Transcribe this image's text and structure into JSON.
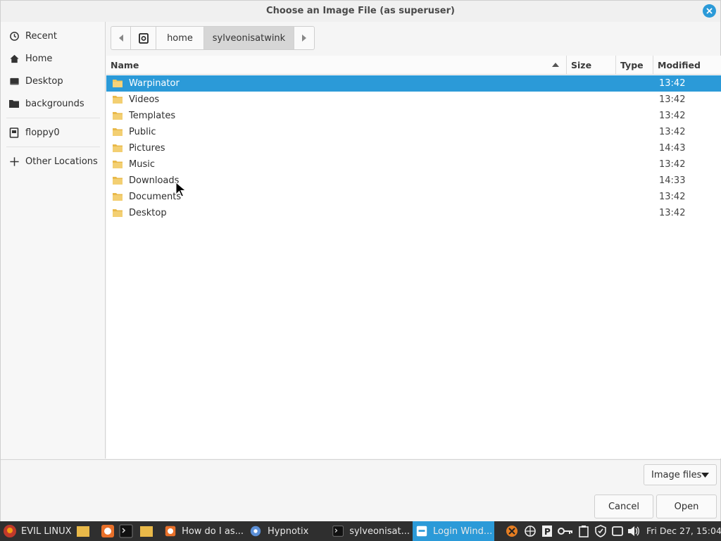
{
  "window": {
    "title": "Choose an Image File (as superuser)"
  },
  "sidebar": {
    "items": [
      {
        "label": "Recent",
        "icon": "clock-icon"
      },
      {
        "label": "Home",
        "icon": "home-icon"
      },
      {
        "label": "Desktop",
        "icon": "desktop-icon"
      },
      {
        "label": "backgrounds",
        "icon": "folder-icon"
      },
      {
        "label": "floppy0",
        "icon": "drive-icon"
      },
      {
        "label": "Other Locations",
        "icon": "plus-icon"
      }
    ]
  },
  "pathbar": {
    "segments": [
      "home",
      "sylveonisatwink"
    ]
  },
  "columns": {
    "name": "Name",
    "size": "Size",
    "type": "Type",
    "modified": "Modified"
  },
  "files": [
    {
      "name": "Warpinator",
      "modified": "13:42",
      "selected": true
    },
    {
      "name": "Videos",
      "modified": "13:42"
    },
    {
      "name": "Templates",
      "modified": "13:42"
    },
    {
      "name": "Public",
      "modified": "13:42"
    },
    {
      "name": "Pictures",
      "modified": "14:43"
    },
    {
      "name": "Music",
      "modified": "13:42"
    },
    {
      "name": "Downloads",
      "modified": "14:33"
    },
    {
      "name": "Documents",
      "modified": "13:42"
    },
    {
      "name": "Desktop",
      "modified": "13:42"
    }
  ],
  "bottom": {
    "filter": "Image files",
    "cancel": "Cancel",
    "open": "Open"
  },
  "taskbar": {
    "menu": "EVIL LINUX",
    "windows": [
      {
        "label": "How do I as..."
      },
      {
        "label": "Hypnotix"
      },
      {
        "label": "sylveonisat..."
      },
      {
        "label": "Login Wind...",
        "active": true
      }
    ],
    "clock": "Fri Dec 27, 15:04"
  },
  "colors": {
    "accent": "#2b9ad8",
    "folder": "#f0c75e",
    "taskbar": "#2f2f2f"
  }
}
